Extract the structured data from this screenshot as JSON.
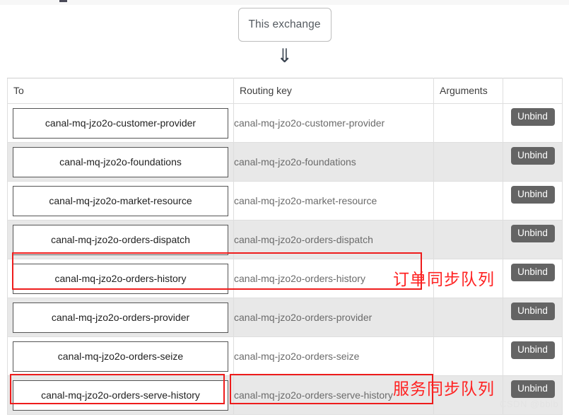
{
  "exchange_node": {
    "label": "This exchange",
    "arrow_glyph": "⇓"
  },
  "bindings_table": {
    "columns": [
      "To",
      "Routing key",
      "Arguments",
      ""
    ],
    "unbind_label": "Unbind",
    "rows": [
      {
        "to": "canal-mq-jzo2o-customer-provider",
        "routing_key": "canal-mq-jzo2o-customer-provider",
        "arguments": "",
        "action": "Unbind"
      },
      {
        "to": "canal-mq-jzo2o-foundations",
        "routing_key": "canal-mq-jzo2o-foundations",
        "arguments": "",
        "action": "Unbind"
      },
      {
        "to": "canal-mq-jzo2o-market-resource",
        "routing_key": "canal-mq-jzo2o-market-resource",
        "arguments": "",
        "action": "Unbind"
      },
      {
        "to": "canal-mq-jzo2o-orders-dispatch",
        "routing_key": "canal-mq-jzo2o-orders-dispatch",
        "arguments": "",
        "action": "Unbind"
      },
      {
        "to": "canal-mq-jzo2o-orders-history",
        "routing_key": "canal-mq-jzo2o-orders-history",
        "arguments": "",
        "action": "Unbind"
      },
      {
        "to": "canal-mq-jzo2o-orders-provider",
        "routing_key": "canal-mq-jzo2o-orders-provider",
        "arguments": "",
        "action": "Unbind"
      },
      {
        "to": "canal-mq-jzo2o-orders-seize",
        "routing_key": "canal-mq-jzo2o-orders-seize",
        "arguments": "",
        "action": "Unbind"
      },
      {
        "to": "canal-mq-jzo2o-orders-serve-history",
        "routing_key": "canal-mq-jzo2o-orders-serve-history",
        "arguments": "",
        "action": "Unbind"
      }
    ]
  },
  "annotations": {
    "accent_color": "#ff2222",
    "orders_history_note": "订单同步队列",
    "serve_history_note": "服务同步队列"
  },
  "watermark": {
    "text": "CSDN @bblb"
  }
}
